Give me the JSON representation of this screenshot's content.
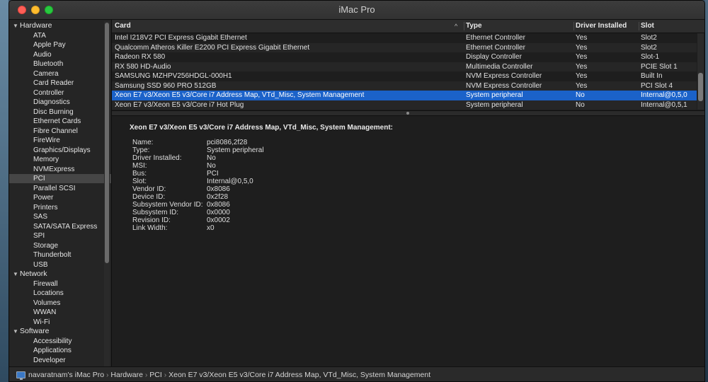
{
  "window": {
    "title": "iMac Pro"
  },
  "sidebar": {
    "items": [
      {
        "label": "Hardware",
        "kind": "section"
      },
      {
        "label": "ATA",
        "kind": "child"
      },
      {
        "label": "Apple Pay",
        "kind": "child"
      },
      {
        "label": "Audio",
        "kind": "child"
      },
      {
        "label": "Bluetooth",
        "kind": "child"
      },
      {
        "label": "Camera",
        "kind": "child"
      },
      {
        "label": "Card Reader",
        "kind": "child"
      },
      {
        "label": "Controller",
        "kind": "child"
      },
      {
        "label": "Diagnostics",
        "kind": "child"
      },
      {
        "label": "Disc Burning",
        "kind": "child"
      },
      {
        "label": "Ethernet Cards",
        "kind": "child"
      },
      {
        "label": "Fibre Channel",
        "kind": "child"
      },
      {
        "label": "FireWire",
        "kind": "child"
      },
      {
        "label": "Graphics/Displays",
        "kind": "child"
      },
      {
        "label": "Memory",
        "kind": "child"
      },
      {
        "label": "NVMExpress",
        "kind": "child"
      },
      {
        "label": "PCI",
        "kind": "child",
        "selected": true
      },
      {
        "label": "Parallel SCSI",
        "kind": "child"
      },
      {
        "label": "Power",
        "kind": "child"
      },
      {
        "label": "Printers",
        "kind": "child"
      },
      {
        "label": "SAS",
        "kind": "child"
      },
      {
        "label": "SATA/SATA Express",
        "kind": "child"
      },
      {
        "label": "SPI",
        "kind": "child"
      },
      {
        "label": "Storage",
        "kind": "child"
      },
      {
        "label": "Thunderbolt",
        "kind": "child"
      },
      {
        "label": "USB",
        "kind": "child"
      },
      {
        "label": "Network",
        "kind": "section"
      },
      {
        "label": "Firewall",
        "kind": "child"
      },
      {
        "label": "Locations",
        "kind": "child"
      },
      {
        "label": "Volumes",
        "kind": "child"
      },
      {
        "label": "WWAN",
        "kind": "child"
      },
      {
        "label": "Wi-Fi",
        "kind": "child"
      },
      {
        "label": "Software",
        "kind": "section"
      },
      {
        "label": "Accessibility",
        "kind": "child"
      },
      {
        "label": "Applications",
        "kind": "child"
      },
      {
        "label": "Developer",
        "kind": "child"
      }
    ]
  },
  "table": {
    "columns": [
      "Card",
      "Type",
      "Driver Installed",
      "Slot"
    ],
    "sort_indicator": "^",
    "rows": [
      {
        "card": "Intel I218V2 PCI Express Gigabit Ethernet",
        "type": "Ethernet Controller",
        "driver": "Yes",
        "slot": "Slot2"
      },
      {
        "card": "Qualcomm Atheros Killer E2200 PCI Express Gigabit Ethernet",
        "type": "Ethernet Controller",
        "driver": "Yes",
        "slot": "Slot2"
      },
      {
        "card": "Radeon RX 580",
        "type": "Display Controller",
        "driver": "Yes",
        "slot": "Slot-1"
      },
      {
        "card": "RX 580 HD-Audio",
        "type": "Multimedia Controller",
        "driver": "Yes",
        "slot": "PCIE Slot 1"
      },
      {
        "card": "SAMSUNG MZHPV256HDGL-000H1",
        "type": "NVM Express Controller",
        "driver": "Yes",
        "slot": "Built In"
      },
      {
        "card": "Samsung SSD 960 PRO 512GB",
        "type": "NVM Express Controller",
        "driver": "Yes",
        "slot": "PCI Slot 4"
      },
      {
        "card": "Xeon E7 v3/Xeon E5 v3/Core i7 Address Map, VTd_Misc, System Management",
        "type": "System peripheral",
        "driver": "No",
        "slot": "Internal@0,5,0",
        "selected": true
      },
      {
        "card": "Xeon E7 v3/Xeon E5 v3/Core i7 Hot Plug",
        "type": "System peripheral",
        "driver": "No",
        "slot": "Internal@0,5,1"
      }
    ]
  },
  "detail": {
    "title": "Xeon E7 v3/Xeon E5 v3/Core i7 Address Map, VTd_Misc, System Management:",
    "fields": [
      {
        "label": "Name:",
        "value": "pci8086,2f28"
      },
      {
        "label": "Type:",
        "value": "System peripheral"
      },
      {
        "label": "Driver Installed:",
        "value": "No"
      },
      {
        "label": "MSI:",
        "value": "No"
      },
      {
        "label": "Bus:",
        "value": "PCI"
      },
      {
        "label": "Slot:",
        "value": "Internal@0,5,0"
      },
      {
        "label": "Vendor ID:",
        "value": "0x8086"
      },
      {
        "label": "Device ID:",
        "value": "0x2f28"
      },
      {
        "label": "Subsystem Vendor ID:",
        "value": "0x8086"
      },
      {
        "label": "Subsystem ID:",
        "value": "0x0000"
      },
      {
        "label": "Revision ID:",
        "value": "0x0002"
      },
      {
        "label": "Link Width:",
        "value": "x0"
      }
    ]
  },
  "statusbar": {
    "icon": "computer-icon",
    "separator": "›",
    "path": [
      "navaratnam's iMac Pro",
      "Hardware",
      "PCI",
      "Xeon E7 v3/Xeon E5 v3/Core i7 Address Map, VTd_Misc, System Management"
    ]
  },
  "colors": {
    "selection": "#1b62c9",
    "close": "#ff5f57",
    "minimize": "#febc2e",
    "maximize": "#28c840"
  }
}
